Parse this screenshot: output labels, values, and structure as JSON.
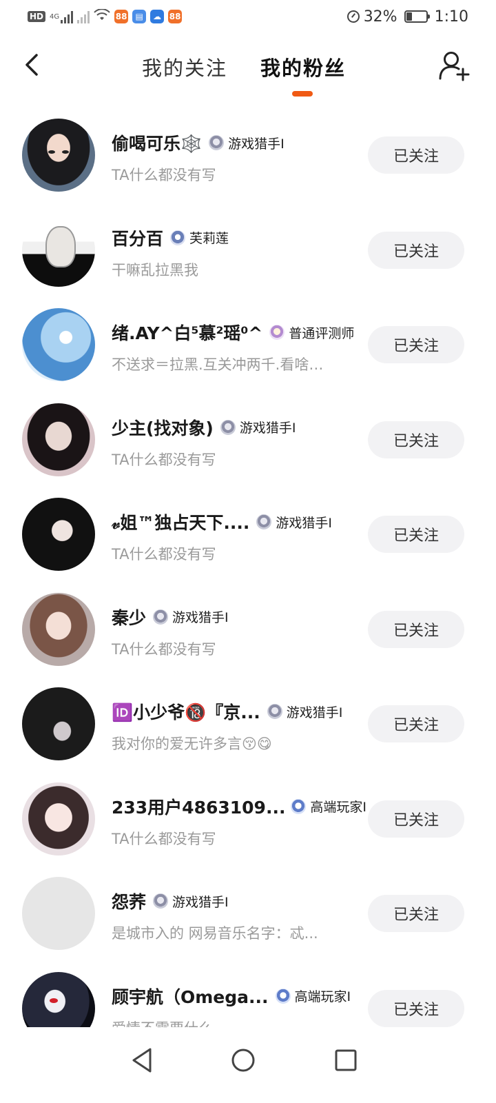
{
  "status_bar": {
    "hd_label": "HD",
    "network_label": "4G",
    "app_icons": [
      {
        "name": "app-icon-orange",
        "glyph": "88",
        "color": "#f0702a"
      },
      {
        "name": "app-icon-blue",
        "glyph": "▤",
        "color": "#4a8de8"
      },
      {
        "name": "app-icon-cloud",
        "glyph": "☁",
        "color": "#2f7be0"
      },
      {
        "name": "app-icon-orange-2",
        "glyph": "88",
        "color": "#f0702a"
      }
    ],
    "battery_percent_label": "32%",
    "battery_level": 0.32,
    "time": "1:10"
  },
  "header": {
    "tabs": [
      {
        "label": "我的关注",
        "active": false
      },
      {
        "label": "我的粉丝",
        "active": true
      }
    ],
    "accent_color": "#f05a14"
  },
  "fans": [
    {
      "nickname": "偷喝可乐🕸️",
      "badge": "游戏猎手I",
      "badge_kind": "hunter",
      "bio": "TA什么都没有写",
      "button": "已关注"
    },
    {
      "nickname": "百分百",
      "badge": "芙莉莲",
      "badge_kind": "jasmine",
      "bio": "干嘛乱拉黑我",
      "button": "已关注"
    },
    {
      "nickname": "绪.AY^白⁵慕²瑶⁰^",
      "badge": "普通评测师",
      "badge_kind": "critic",
      "bio": "不送求＝拉黑.互关冲两千.看啥…",
      "button": "已关注"
    },
    {
      "nickname": "少主(找对象)",
      "badge": "游戏猎手I",
      "badge_kind": "hunter",
      "bio": "TA什么都没有写",
      "button": "已关注"
    },
    {
      "nickname": "𝓋姐™独占天下....",
      "badge": "游戏猎手I",
      "badge_kind": "hunter",
      "bio": "TA什么都没有写",
      "button": "已关注"
    },
    {
      "nickname": "秦少",
      "badge": "游戏猎手I",
      "badge_kind": "hunter",
      "bio": "TA什么都没有写",
      "button": "已关注"
    },
    {
      "nickname": "🆔小少爷🔞『京...",
      "badge": "游戏猎手I",
      "badge_kind": "hunter",
      "bio": "我对你的爱无许多言😚😋",
      "button": "已关注"
    },
    {
      "nickname": "233用户4863109...",
      "badge": "高端玩家I",
      "badge_kind": "pro",
      "bio": "TA什么都没有写",
      "button": "已关注"
    },
    {
      "nickname": "怨荞",
      "badge": "游戏猎手I",
      "badge_kind": "hunter",
      "bio": "是城市入的  网易音乐名字：忒...",
      "button": "已关注"
    },
    {
      "nickname": "顾宇航（Omega...",
      "badge": "高端玩家I",
      "badge_kind": "pro",
      "bio": "爱情不需要什么",
      "button": "已关注"
    }
  ]
}
